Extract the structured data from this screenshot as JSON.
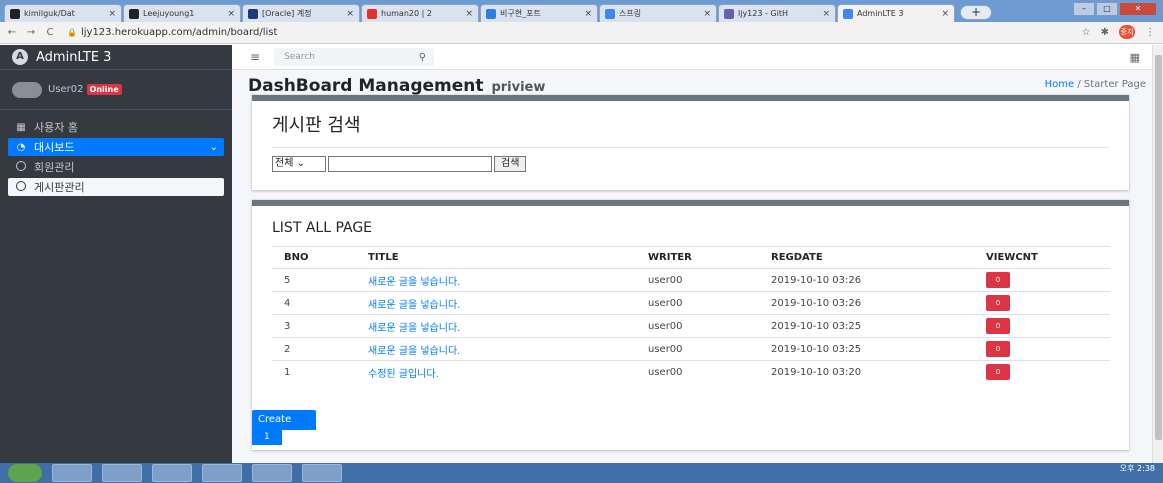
{
  "browser": {
    "tabs": [
      {
        "label": "kimilguk/Dat",
        "icon": "github-icon",
        "color": "#222222",
        "active": false
      },
      {
        "label": "Leejuyoung1",
        "icon": "github-icon",
        "color": "#222222",
        "active": false
      },
      {
        "label": "[Oracle] 계정",
        "icon": "bar-chart-icon",
        "color": "#1a3b7a",
        "active": false
      },
      {
        "label": "human20 | 2",
        "icon": "circle-icon",
        "color": "#e5322d",
        "active": false
      },
      {
        "label": "비구현_포트",
        "icon": "doc-icon",
        "color": "#2b7de0",
        "active": false
      },
      {
        "label": "스프링",
        "icon": "google-icon",
        "color": "#4285f4",
        "active": false
      },
      {
        "label": "ljy123 - GitH",
        "icon": "heroku-icon",
        "color": "#6762a6",
        "active": false
      },
      {
        "label": "AdminLTE 3",
        "icon": "google-icon",
        "color": "#4285f4",
        "active": true
      }
    ],
    "url": "ljy123.herokuapp.com/admin/board/list",
    "profile_label": "중지"
  },
  "sidebar": {
    "brand": "AdminLTE 3",
    "brand_logo": "A",
    "user": {
      "name": "User02",
      "status": "Online"
    },
    "items": [
      {
        "label": "사용자 홈",
        "icon": "table-icon",
        "state": "normal"
      },
      {
        "label": "대시보드",
        "icon": "dashboard-icon",
        "state": "active"
      },
      {
        "label": "회원관리",
        "icon": "circle-outline-icon",
        "state": "normal"
      },
      {
        "label": "게시판관리",
        "icon": "circle-outline-icon",
        "state": "selected"
      }
    ]
  },
  "topnav": {
    "search_placeholder": "Search"
  },
  "header": {
    "title": "DashBoard Management",
    "subtitle": "priview",
    "breadcrumb": {
      "home": "Home",
      "separator": "/",
      "current": "Starter Page"
    }
  },
  "search_card": {
    "title": "게시판 검색",
    "select_value": "전체",
    "keyword_value": "",
    "button": "검색"
  },
  "list_card": {
    "title": "LIST ALL PAGE",
    "columns": [
      "BNO",
      "TITLE",
      "WRITER",
      "REGDATE",
      "VIEWCNT"
    ],
    "rows": [
      {
        "bno": "5",
        "title": "새로운 글을 넣습니다.",
        "writer": "user00",
        "regdate": "2019-10-10 03:26",
        "viewcnt": "0"
      },
      {
        "bno": "4",
        "title": "새로운 글을 넣습니다.",
        "writer": "user00",
        "regdate": "2019-10-10 03:26",
        "viewcnt": "0"
      },
      {
        "bno": "3",
        "title": "새로운 글을 넣습니다.",
        "writer": "user00",
        "regdate": "2019-10-10 03:25",
        "viewcnt": "0"
      },
      {
        "bno": "2",
        "title": "새로운 글을 넣습니다.",
        "writer": "user00",
        "regdate": "2019-10-10 03:25",
        "viewcnt": "0"
      },
      {
        "bno": "1",
        "title": "수정된 글입니다.",
        "writer": "user00",
        "regdate": "2019-10-10 03:20",
        "viewcnt": "0"
      }
    ],
    "create_button": "Create",
    "page": "1"
  },
  "taskbar": {
    "time": "오후 2:38"
  },
  "colors": {
    "primary": "#007bff",
    "danger": "#dc3545",
    "sidebar_bg": "#343a40"
  }
}
